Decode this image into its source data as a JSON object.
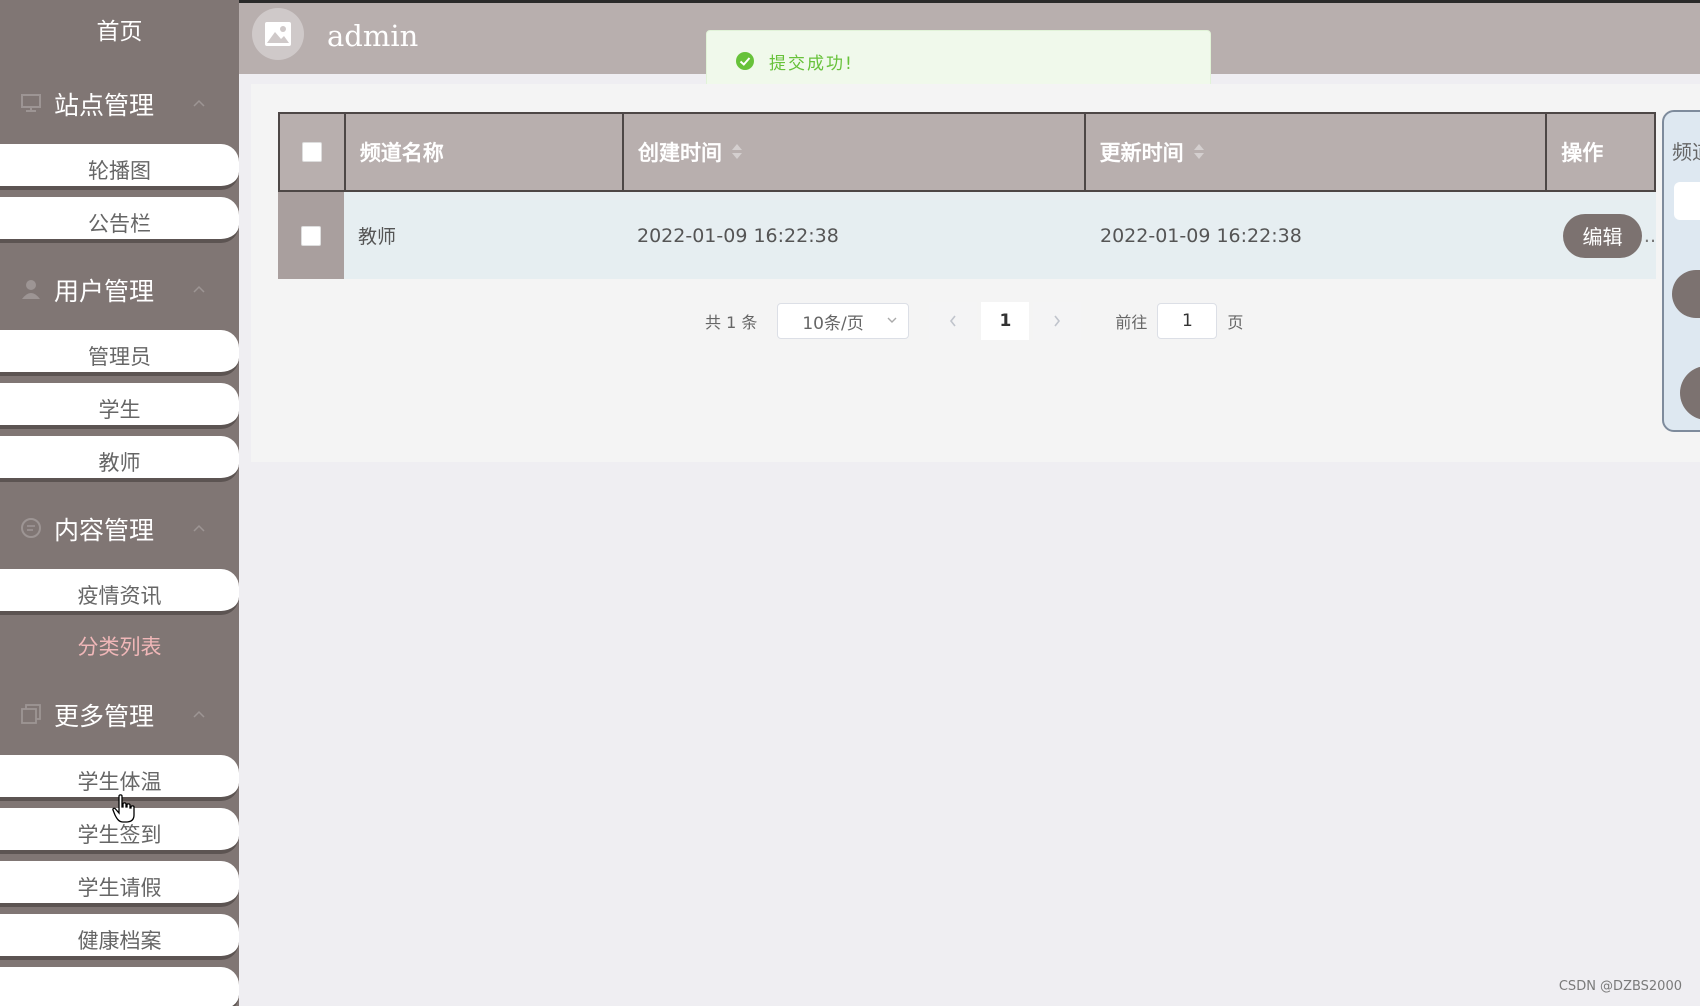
{
  "sidebar": {
    "home": "首页",
    "groups": [
      {
        "label": "站点管理",
        "icon": "monitor-icon",
        "items": [
          "轮播图",
          "公告栏"
        ]
      },
      {
        "label": "用户管理",
        "icon": "user-icon",
        "items": [
          "管理员",
          "学生",
          "教师"
        ]
      },
      {
        "label": "内容管理",
        "icon": "message-icon",
        "items": [
          "疫情资讯",
          "分类列表"
        ]
      },
      {
        "label": "更多管理",
        "icon": "copy-icon",
        "items": [
          "学生体温",
          "学生签到",
          "学生请假",
          "健康档案"
        ]
      }
    ],
    "active_item": "分类列表"
  },
  "header": {
    "username": "admin"
  },
  "toast": {
    "message": "提交成功!"
  },
  "table": {
    "columns": [
      "频道名称",
      "创建时间",
      "更新时间",
      "操作"
    ],
    "rows": [
      {
        "name": "教师",
        "created": "2022-01-09 16:22:38",
        "updated": "2022-01-09 16:22:38",
        "action": "编辑",
        "more": ".."
      }
    ]
  },
  "pagination": {
    "total": "共 1 条",
    "page_size": "10条/页",
    "current_page": "1",
    "goto_label": "前往",
    "goto_value": "1",
    "page_suffix": "页"
  },
  "side_form": {
    "label": "频道"
  },
  "watermark": "CSDN @DZBS2000",
  "colors": {
    "sidebar": "#807674",
    "header": "#b8afae",
    "active": "#f0b7b8",
    "success": "#67c23a"
  }
}
